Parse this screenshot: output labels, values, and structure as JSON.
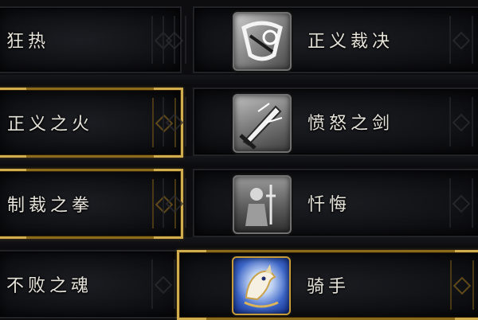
{
  "rows": [
    {
      "left": {
        "label": "狂热",
        "selected": false
      },
      "right": {
        "label": "正义裁决",
        "selected": false,
        "icon": "justice-verdict-icon"
      }
    },
    {
      "left": {
        "label": "正义之火",
        "selected": true
      },
      "right": {
        "label": "愤怒之剑",
        "selected": false,
        "icon": "sword-of-wrath-icon"
      }
    },
    {
      "left": {
        "label": "制裁之拳",
        "selected": true
      },
      "right": {
        "label": "忏悔",
        "selected": false,
        "icon": "repentance-icon"
      }
    },
    {
      "left": {
        "label": "不败之魂",
        "selected": false
      },
      "right": {
        "label": "骑手",
        "selected": true,
        "icon": "horseman-icon"
      }
    }
  ],
  "colors": {
    "background": "#0d0d10",
    "panel": "#101115",
    "gold_border": "#d2ad4e",
    "text": "#e6e3da",
    "icon_blue": "#3d66c8"
  }
}
